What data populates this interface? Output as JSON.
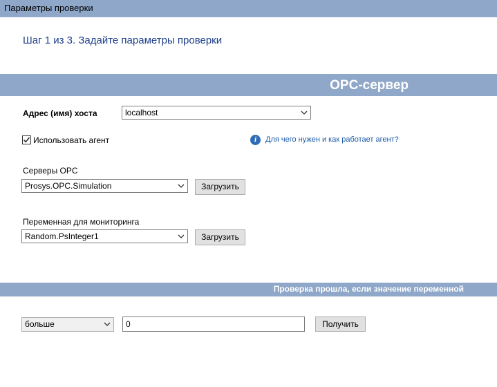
{
  "window": {
    "title": "Параметры проверки"
  },
  "step": {
    "text": "Шаг 1 из 3. Задайте параметры проверки"
  },
  "opc_section": {
    "title": "OPC-сервер"
  },
  "host": {
    "label": "Адрес (имя) хоста",
    "value": "localhost"
  },
  "agent": {
    "checkbox_label": "Использовать агент",
    "checked": true,
    "help_link": "Для чего нужен и как работает агент?"
  },
  "opc_servers": {
    "label": "Серверы OPC",
    "value": "Prosys.OPC.Simulation",
    "load_button": "Загрузить"
  },
  "monitor_var": {
    "label": "Переменная для мониторинга",
    "value": "Random.PsInteger1",
    "load_button": "Загрузить"
  },
  "condition_section": {
    "title": "Проверка прошла, если значение переменной"
  },
  "condition": {
    "operator": "больше",
    "value": "0",
    "get_button": "Получить"
  },
  "icons": {
    "dropdown": "chevron-down-icon",
    "info": "info-icon",
    "check": "check-icon"
  }
}
